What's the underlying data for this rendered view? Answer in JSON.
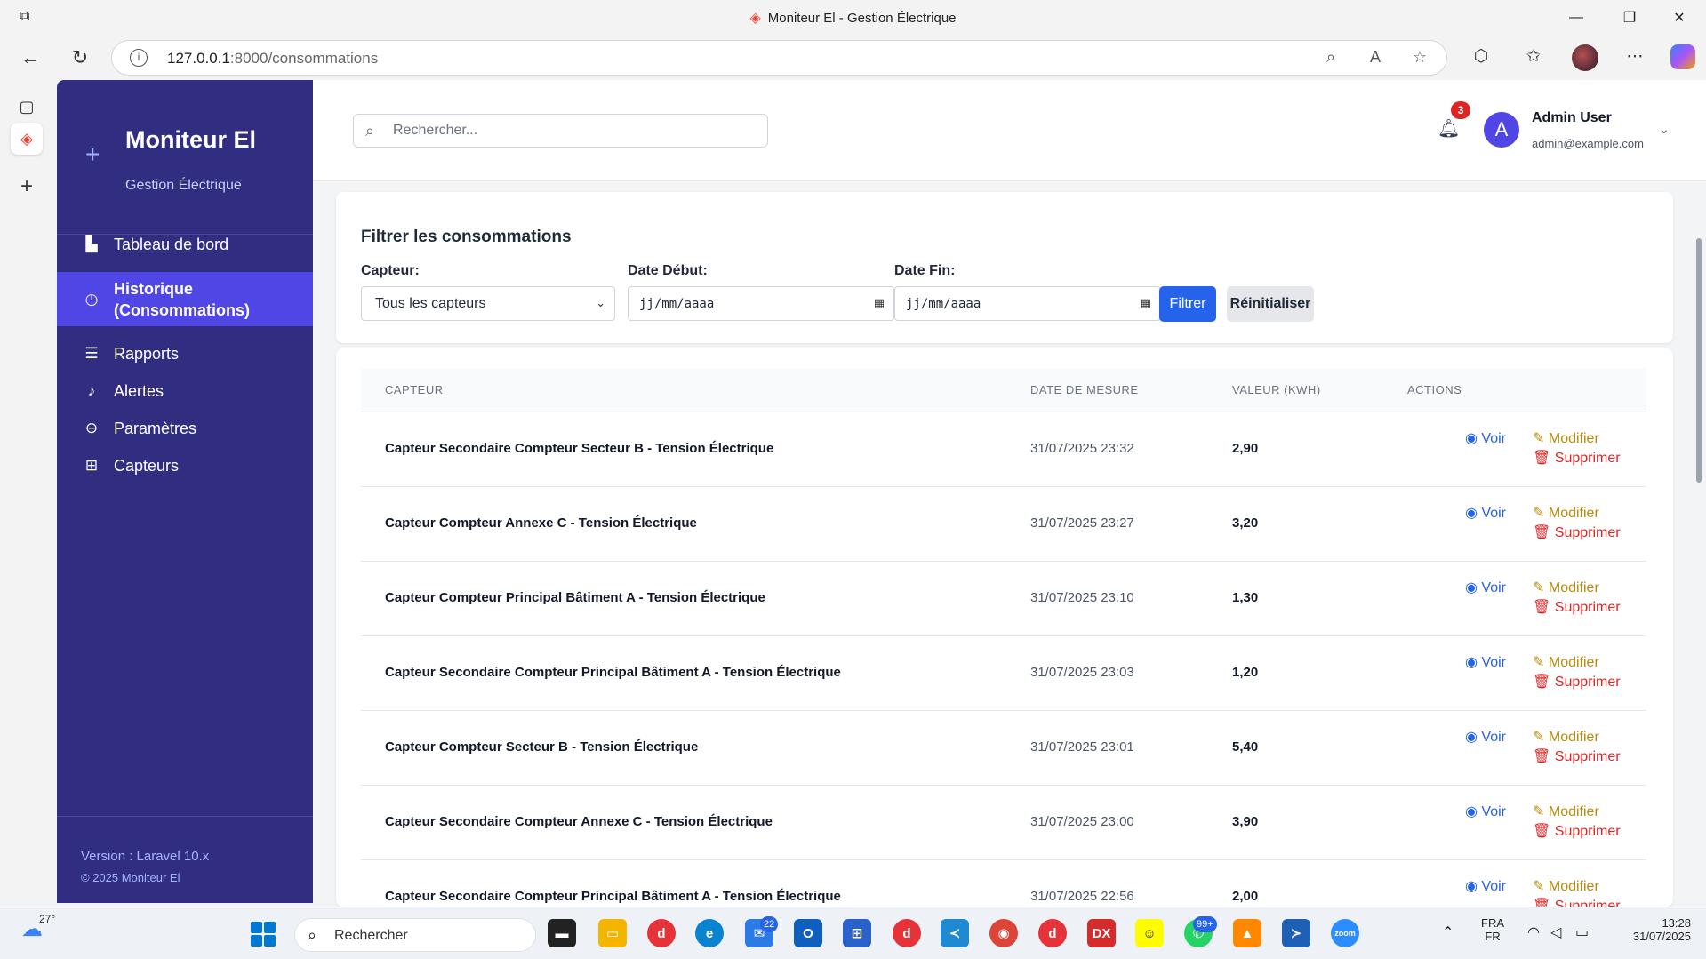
{
  "browser": {
    "window_title": "Moniteur El - Gestion Électrique",
    "url_host": "127.0.0.1",
    "url_path": ":8000/consommations"
  },
  "sidebar": {
    "brand_name": "Moniteur El",
    "brand_sub": "Gestion Électrique",
    "items": [
      {
        "label": "Tableau de bord",
        "icon": "dashboard-icon"
      },
      {
        "label": "Historique",
        "label2": "(Consommations)",
        "icon": "clock-icon"
      },
      {
        "label": "Rapports",
        "icon": "list-icon"
      },
      {
        "label": "Alertes",
        "icon": "bell-icon"
      },
      {
        "label": "Paramètres",
        "icon": "settings-icon"
      },
      {
        "label": "Capteurs",
        "icon": "sensor-icon"
      }
    ],
    "version": "Version : Laravel 10.x",
    "copyright": "© 2025 Moniteur El"
  },
  "topbar": {
    "search_placeholder": "Rechercher...",
    "notif_count": "3",
    "avatar_letter": "A",
    "user_name": "Admin User",
    "user_email": "admin@example.com"
  },
  "filter": {
    "title": "Filtrer les consommations",
    "capteur_label": "Capteur:",
    "capteur_value": "Tous les capteurs",
    "date_debut_label": "Date Début:",
    "date_debut_placeholder": "jj/mm/aaaa",
    "date_fin_label": "Date Fin:",
    "date_fin_placeholder": "jj/mm/aaaa",
    "filter_btn": "Filtrer",
    "reset_btn": "Réinitialiser"
  },
  "table": {
    "headers": [
      "CAPTEUR",
      "DATE DE MESURE",
      "VALEUR (KWH)",
      "ACTIONS"
    ],
    "action_voir": "Voir",
    "action_modifier": "Modifier",
    "action_supprimer": "Supprimer",
    "rows": [
      {
        "capteur": "Capteur Secondaire Compteur Secteur B - Tension Électrique",
        "date": "31/07/2025 23:32",
        "valeur": "2,90"
      },
      {
        "capteur": "Capteur Compteur Annexe C - Tension Électrique",
        "date": "31/07/2025 23:27",
        "valeur": "3,20"
      },
      {
        "capteur": "Capteur Compteur Principal Bâtiment A - Tension Électrique",
        "date": "31/07/2025 23:10",
        "valeur": "1,30"
      },
      {
        "capteur": "Capteur Secondaire Compteur Principal Bâtiment A - Tension Électrique",
        "date": "31/07/2025 23:03",
        "valeur": "1,20"
      },
      {
        "capteur": "Capteur Compteur Secteur B - Tension Électrique",
        "date": "31/07/2025 23:01",
        "valeur": "5,40"
      },
      {
        "capteur": "Capteur Secondaire Compteur Annexe C - Tension Électrique",
        "date": "31/07/2025 23:00",
        "valeur": "3,90"
      },
      {
        "capteur": "Capteur Secondaire Compteur Principal Bâtiment A - Tension Électrique",
        "date": "31/07/2025 22:56",
        "valeur": "2,00"
      }
    ]
  },
  "taskbar": {
    "temperature": "27°",
    "search_text": "Rechercher",
    "mail_badge": "22",
    "whatsapp_badge": "99+",
    "lang1": "FRA",
    "lang2": "FR",
    "time": "13:28",
    "date": "31/07/2025"
  },
  "colors": {
    "sidebar": "#312e81",
    "sidebar_active": "#4f46e5",
    "primary": "#2563eb",
    "danger": "#dc2626",
    "warning": "#b98a0b"
  }
}
